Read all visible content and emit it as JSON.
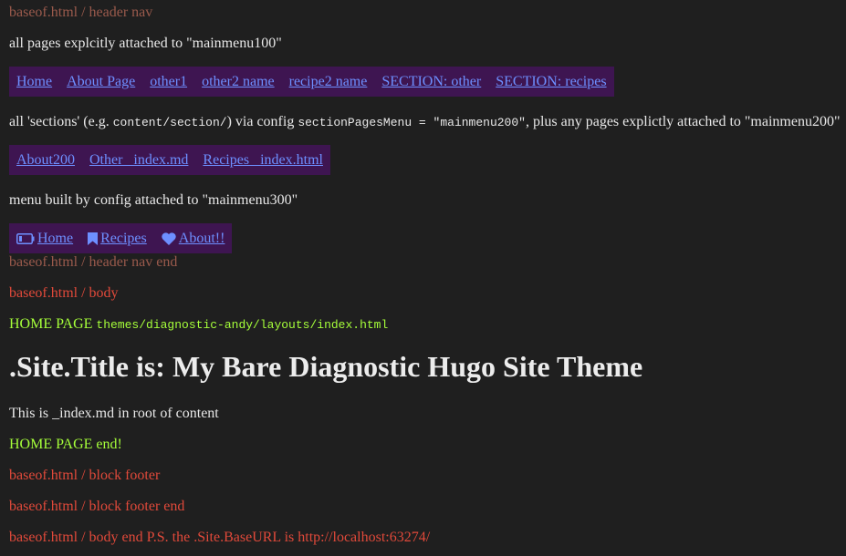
{
  "header_nav_start": "baseof.html / header nav",
  "menu100": {
    "caption": "all pages explcitly attached to \"mainmenu100\"",
    "items": [
      "Home",
      "About Page",
      "other1",
      "other2 name",
      "recipe2 name",
      "SECTION: other",
      "SECTION: recipes"
    ]
  },
  "menu200": {
    "caption_a": "all 'sections' (e.g. ",
    "caption_code1": "content/section/",
    "caption_b": ") via config ",
    "caption_code2": "sectionPagesMenu = \"mainmenu200\"",
    "caption_c": ", plus any pages explictly attached to \"mainmenu200\"",
    "items": [
      "About200",
      "Other _index.md",
      "Recipes _index.html"
    ]
  },
  "menu300": {
    "caption": "menu built by config attached to \"mainmenu300\"",
    "items": [
      {
        "label": "Home",
        "icon": "battery-icon"
      },
      {
        "label": "Recipes",
        "icon": "bookmark-icon"
      },
      {
        "label": "About!!",
        "icon": "heart-icon"
      }
    ]
  },
  "header_nav_end": "baseof.html / header nav end",
  "body_start": "baseof.html / body",
  "home": {
    "label": "HOME PAGE",
    "path": "themes/diagnostic-andy/layouts/index.html",
    "site_title": ".Site.Title is: My Bare Diagnostic Hugo Site Theme",
    "content": "This is _index.md in root of content",
    "end": "HOME PAGE end!"
  },
  "footer_start": "baseof.html / block footer",
  "footer_end": "baseof.html / block footer end",
  "body_end": "baseof.html / body end P.S. the .Site.BaseURL is http://localhost:63274/",
  "colors": {
    "nav_bg": "#3e1551",
    "link": "#6d8fff",
    "lime": "#a6ff3a",
    "red": "#e0493a",
    "muted": "#9a5a4c"
  }
}
